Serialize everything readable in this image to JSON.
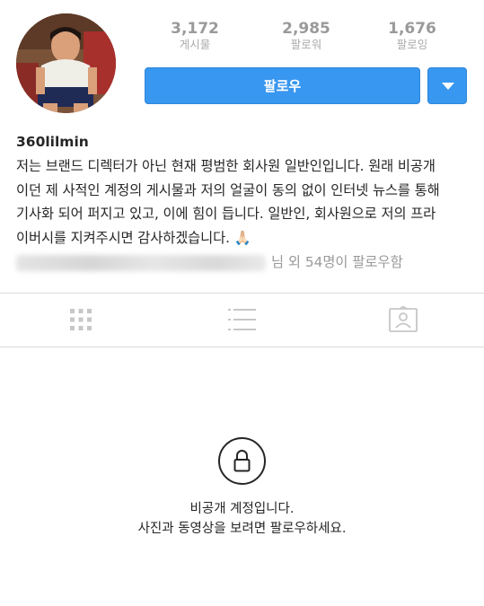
{
  "profile": {
    "username": "360lilmin",
    "bio_lines": [
      "저는 브랜드 디렉터가 아닌 현재 평범한 회사원 일반인입니다. 원래 비공개",
      "이던 제 사적인 계정의 게시물과 저의 얼굴이 동의 없이 인터넷 뉴스를 통해",
      "기사화 되어 퍼지고 있고, 이에 힘이 듭니다. 일반인, 회사원으로 저의 프라",
      "이버시를 지켜주시면 감사하겠습니다. 🙏🏻"
    ],
    "followed_by_suffix": "님 외 54명이 팔로우함"
  },
  "stats": {
    "posts": {
      "count": "3,172",
      "label": "게시물"
    },
    "followers": {
      "count": "2,985",
      "label": "팔로워"
    },
    "following": {
      "count": "1,676",
      "label": "팔로잉"
    }
  },
  "actions": {
    "follow_label": "팔로우",
    "dropdown_icon": "triangle-down-icon"
  },
  "tabs": [
    {
      "icon": "grid-icon"
    },
    {
      "icon": "list-icon"
    },
    {
      "icon": "tagged-photos-icon"
    }
  ],
  "private_notice": {
    "icon": "lock-icon",
    "title": "비공개 계정입니다.",
    "subtitle": "사진과 동영상을 보려면 팔로우하세요."
  },
  "colors": {
    "primary_button": "#3897f0",
    "divider": "#dbdbdb",
    "muted_text": "#999999",
    "text": "#262626"
  }
}
